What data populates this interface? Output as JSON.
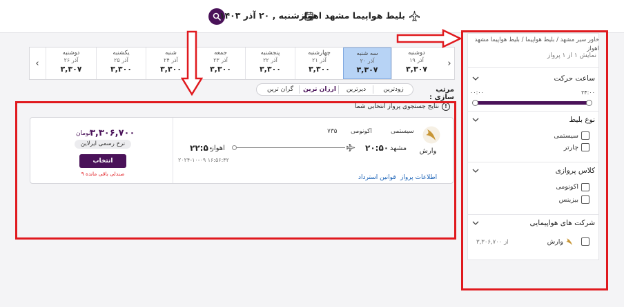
{
  "header": {
    "title": "بلیط هواپیما مشهد اهواز",
    "date": "سه شنبه , ۲۰ آذر ۱۴۰۳"
  },
  "sidebar": {
    "breadcrumb": "خاور سیر مشهد / بلیط هواپیما / بلیط هواپیما مشهد اهواز",
    "result_count": "نمایش ۱ از ۱ پرواز",
    "departure_time": {
      "title": "ساعت حرکت",
      "min": "۰۰:۰۰",
      "max": "۲۴:۰۰"
    },
    "ticket_type": {
      "title": "نوع بلیط",
      "options": [
        "سیستمی",
        "چارتر"
      ]
    },
    "flight_class": {
      "title": "کلاس پروازی",
      "options": [
        "اکونومی",
        "بیزینس"
      ]
    },
    "airlines": {
      "title": "شرکت های هواپیمایی",
      "items": [
        {
          "name": "وارش",
          "price": "از ۳,۳۰۶,۷۰۰"
        }
      ]
    }
  },
  "date_strip": [
    {
      "day": "دوشنبه",
      "date": "۱۹ آذر",
      "price": "۳,۳۰۷"
    },
    {
      "day": "سه شنبه",
      "date": "۲۰ آذر",
      "price": "۳,۳۰۷",
      "selected": true
    },
    {
      "day": "چهارشنبه",
      "date": "۲۱ آذر",
      "price": "۳,۳۰۰"
    },
    {
      "day": "پنجشنبه",
      "date": "۲۲ آذر",
      "price": "۳,۳۰۰"
    },
    {
      "day": "جمعه",
      "date": "۲۳ آذر",
      "price": "۳,۳۰۰"
    },
    {
      "day": "شنبه",
      "date": "۲۴ آذر",
      "price": "۳,۳۰۰"
    },
    {
      "day": "یکشنبه",
      "date": "۲۵ آذر",
      "price": "۳,۳۰۰"
    },
    {
      "day": "دوشنبه",
      "date": "۲۶ آذر",
      "price": "۳,۳۰۷"
    }
  ],
  "sort": {
    "label": "مرتب سازی :",
    "options": [
      "زودترین",
      "دیرترین",
      "ارزان ترین",
      "گران ترین"
    ],
    "active": "ارزان ترین"
  },
  "results_info": "نتایج جستجوی پرواز انتخابی شما",
  "flight": {
    "airline": "وارش",
    "type": "سیستمی",
    "class": "اکونومی",
    "flight_no": "۷۳۵",
    "dep_city": "مشهد",
    "dep_time": "۲۰:۵۰",
    "arr_city": "اهواز",
    "arr_time": "۲۲:۵۰",
    "timestamp": "۲۰۲۴-۱۰-۰۹ ۱۶:۵۶:۴۲",
    "link_info": "اطلاعات پرواز",
    "link_rules": "قوانین استرداد",
    "price": "۳,۳۰۶,۷۰۰",
    "currency": "تومان",
    "fare_badge": "نرخ رسمی ایرلاین",
    "select_label": "انتخاب",
    "seats_left": "۹ صندلی باقی مانده"
  },
  "colors": {
    "brand": "#4a1259",
    "annotation": "#e0191e",
    "selected_date": "#b7d3f5",
    "link": "#1a62b7"
  }
}
